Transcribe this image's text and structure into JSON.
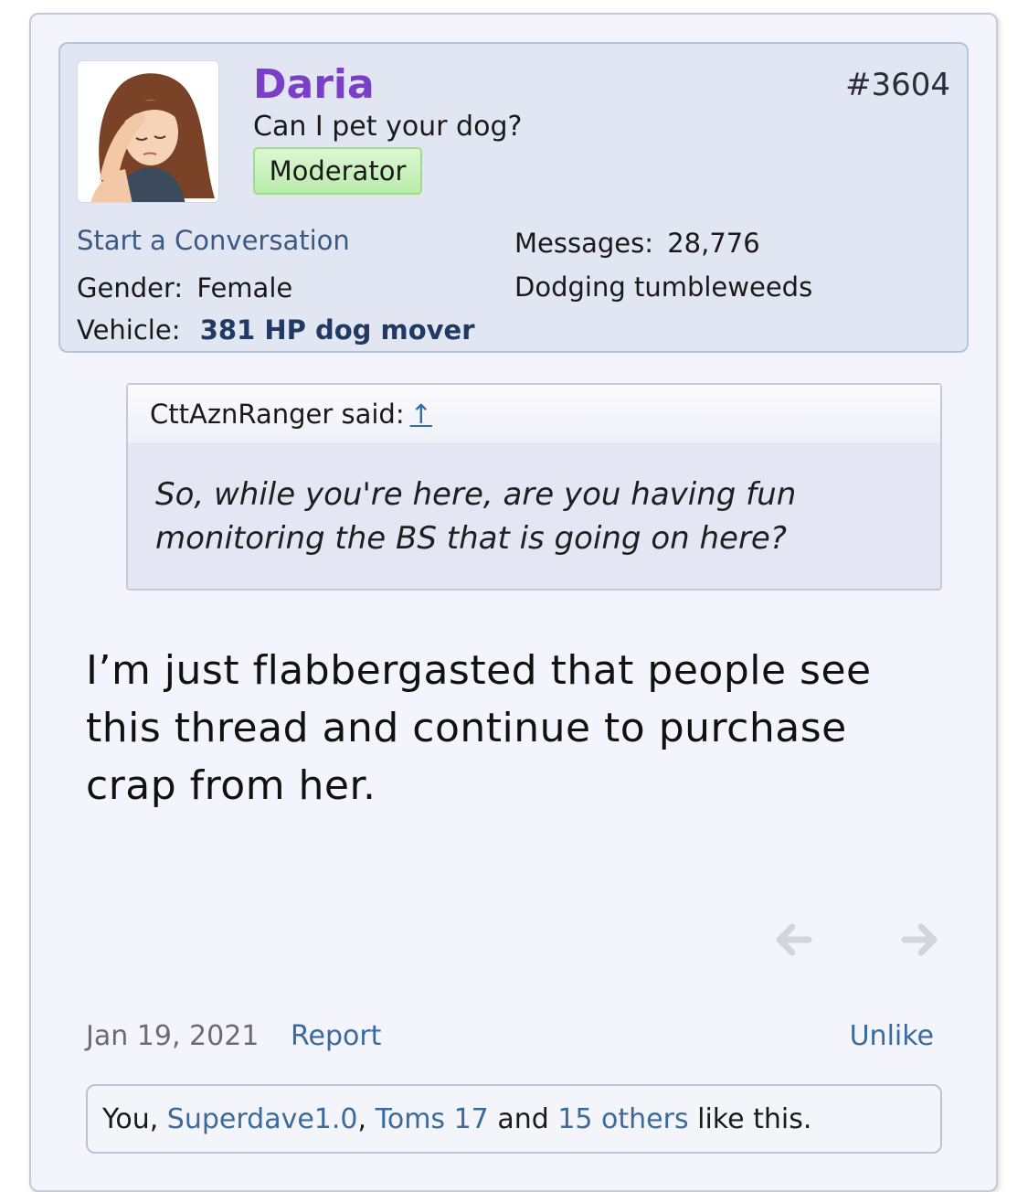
{
  "post": {
    "username": "Daria",
    "post_number": "#3604",
    "user_title": "Can I pet your dog?",
    "badge": "Moderator",
    "start_conversation": "Start a Conversation",
    "gender_label": "Gender:",
    "gender_value": "Female",
    "vehicle_label": "Vehicle:",
    "vehicle_value": "381 HP dog mover",
    "messages_label": "Messages:",
    "messages_value": "28,776",
    "status": "Dodging tumbleweeds",
    "quote": {
      "author": "CttAznRanger said:",
      "arrow": "↑",
      "text": "So, while you're here, are you having fun monitoring the BS that is going on here?"
    },
    "message": "I’m just flabbergasted that people see this thread and continue to purchase crap from her.",
    "nav": {
      "prev_icon": "arrow-left-icon",
      "next_icon": "arrow-right-icon"
    },
    "date": "Jan 19, 2021",
    "report": "Report",
    "unlike": "Unlike",
    "likes": {
      "you": "You,",
      "user1": "Superdave1.0",
      "sep1": ",",
      "user2": "Toms 17",
      "and": "and",
      "others": "15 others",
      "suffix": "like this."
    }
  },
  "colors": {
    "username": "#7b3fc7",
    "link": "#3a6a9e",
    "badge_bg": "#c9f0bb",
    "userblock_bg": "#e2e5f2"
  }
}
